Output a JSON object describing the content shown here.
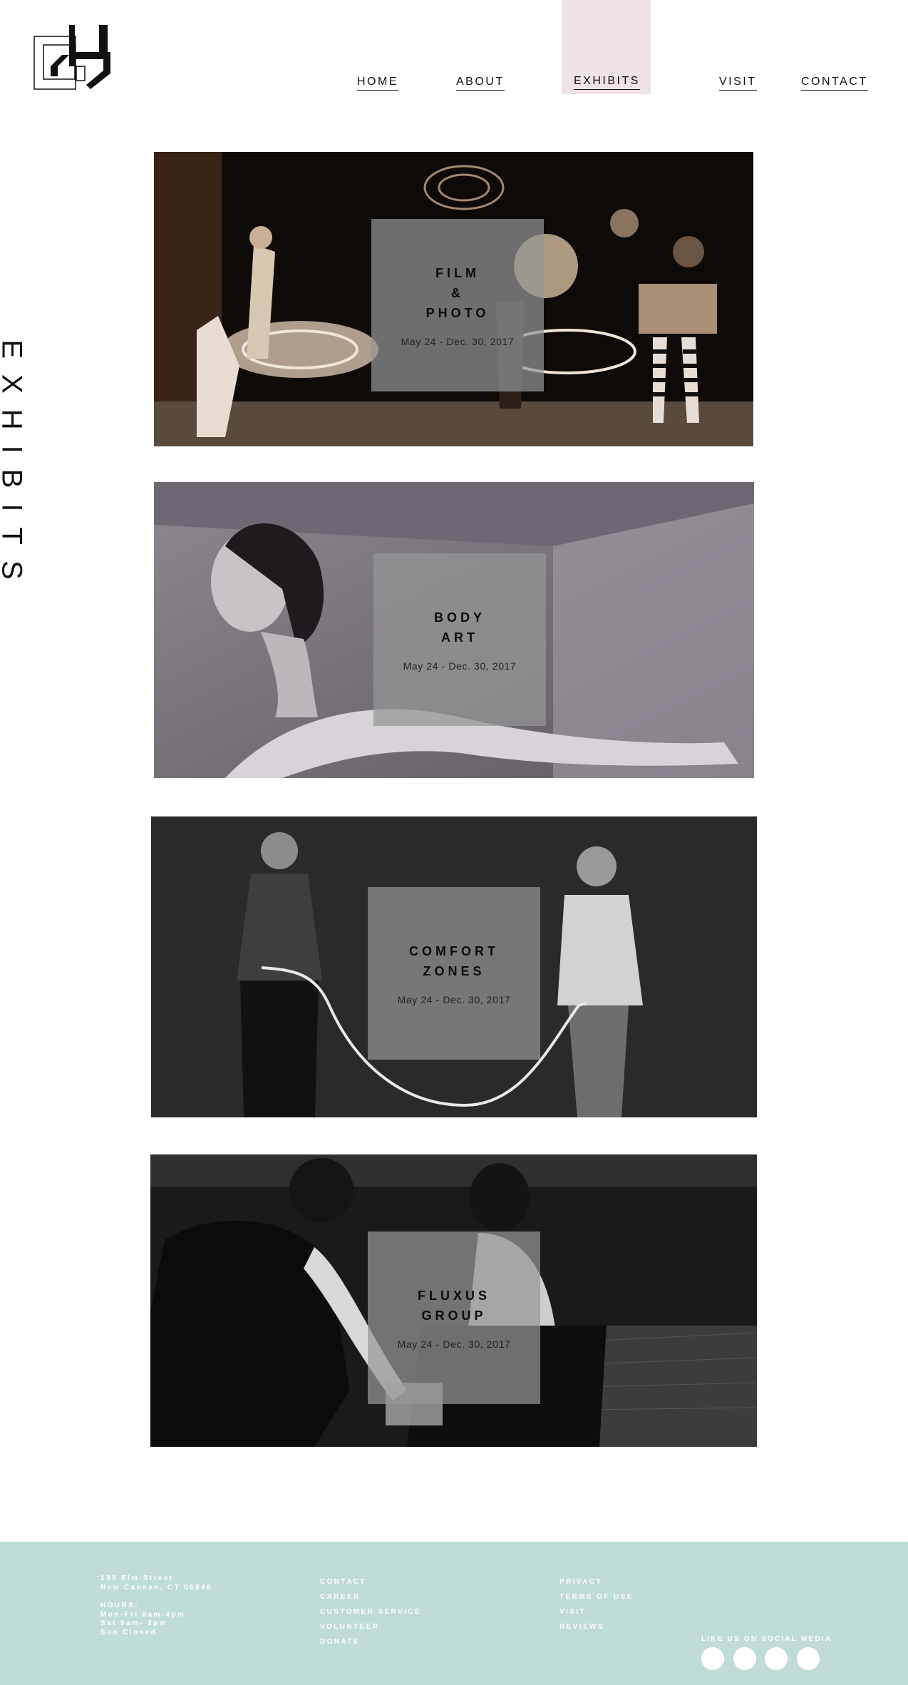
{
  "header": {
    "logo": "museum-logo",
    "nav": [
      {
        "label": "HOME"
      },
      {
        "label": "ABOUT"
      },
      {
        "label": "EXHIBITS",
        "active": true
      },
      {
        "label": "VISIT"
      },
      {
        "label": "CONTACT"
      }
    ],
    "active_highlight_color": "#efe2e8"
  },
  "page": {
    "side_title": "EXHIBITS"
  },
  "exhibits": [
    {
      "title_lines": [
        "FILM",
        "&",
        "PHOTO"
      ],
      "dates": "May 24 - Dec. 30, 2017"
    },
    {
      "title_lines": [
        "BODY",
        "ART"
      ],
      "dates": "May 24 - Dec. 30, 2017"
    },
    {
      "title_lines": [
        "COMFORT",
        "ZONES"
      ],
      "dates": "May 24 - Dec. 30, 2017"
    },
    {
      "title_lines": [
        "FLUXUS",
        "GROUP"
      ],
      "dates": "May 24 - Dec. 30, 2017"
    }
  ],
  "footer": {
    "background": "#c0dcd9",
    "address": [
      "199 Elm Street",
      "New Canaan, CT 06840"
    ],
    "hours": [
      "HOURS:",
      "Mon-Fri 9am-4pm",
      "Sat 9am- 2pm",
      "Sun Closed"
    ],
    "links_1": [
      "CONTACT",
      "CAREER",
      "CUSTOMER SERVICE",
      "VOLUNTEER",
      "DONATE"
    ],
    "links_2": [
      "PRIVACY",
      "TERMS OF USE",
      "VISIT",
      "REVIEWS"
    ],
    "social_label": "LIKE US ON SOCIAL MEDIA",
    "social_icons": [
      "social-icon-1",
      "social-icon-2",
      "social-icon-3",
      "social-icon-4"
    ]
  }
}
